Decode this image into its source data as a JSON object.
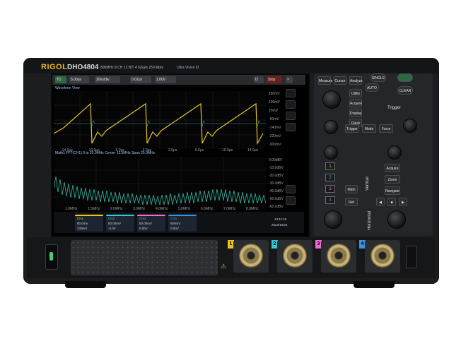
{
  "brand": {
    "logo": "RIGOL",
    "model": "DHO4804",
    "specs": "800MHz  8 CH  12 BIT  4 GSa/s  250 Mpts",
    "badge": "Ultra Vision III"
  },
  "screen": {
    "status": [
      "TD",
      "5.00μs",
      "20ns/div",
      "0.02μs",
      "1.00V",
      "D",
      "Stop"
    ],
    "waveform_title": "Waveform View",
    "zoom_title": "Math1  FFT(CH1)   0 to 25.0MHz   Center 12.5MHz   Span 25.0MHz",
    "wave_right_labels": [
      "180mV",
      "100mV",
      "20mV",
      "-60mV",
      "-140mV",
      "-220mV",
      "-300mV"
    ],
    "wave_bottom_labels": [
      "-14.0μs",
      "-10.0μs",
      "-6.0μs",
      "-2.0μs",
      "2.0μs",
      "6.0μs",
      "10.0μs",
      "14.0μs"
    ],
    "zoom_right_labels": [
      "0.00dBV",
      "-10.0dBV",
      "-20.0dBV",
      "-30.0dBV",
      "-40.0dBV",
      "-50.0dBV",
      "-60.0dBV"
    ],
    "zoom_bottom_labels": [
      "1.0MHz",
      "1.5MHz",
      "2.0MHz",
      "3.0MHz",
      "4.0MHz",
      "5.0MHz",
      "6.0MHz",
      "7.0MHz",
      "8.0MHz"
    ],
    "info_boxes": [
      {
        "ch": "CH1",
        "v1": "80.0mV",
        "v2": "100mV"
      },
      {
        "ch": "CH2",
        "v1": "50.00mV",
        "v2": "-4.0V"
      },
      {
        "ch": "CH3",
        "v1": "50.00mV",
        "v2": "0.00V"
      },
      {
        "ch": "CH4",
        "v1": "500mV",
        "v2": "0.00V"
      }
    ],
    "clock": "13:11:16",
    "date": "2023/10/24"
  },
  "controls": {
    "top_buttons": [
      "Measure",
      "Cursor",
      "Analyze",
      "Utility",
      "Acquire",
      "Display",
      "Quick"
    ],
    "right_round": [
      "SINGLE",
      "AUTO",
      "CLEAR"
    ],
    "trigger_label": "Trigger",
    "trigger_buttons": [
      "Trigger",
      "Mode",
      "Force"
    ],
    "vertical_label": "Vertical",
    "horizontal_label": "Horizontal",
    "numbers": [
      "1",
      "2",
      "3",
      "4"
    ],
    "misc_buttons": [
      "Math",
      "Ref",
      "Acquire",
      "Zoom",
      "Navigate"
    ]
  },
  "colors": {
    "ch1": "#e8c51a",
    "ch2": "#33c7d4",
    "ch3": "#f06cd3",
    "ch4": "#3d8fe0",
    "fft": "#2ab7a5"
  },
  "channels": [
    "1",
    "2",
    "3",
    "4"
  ]
}
